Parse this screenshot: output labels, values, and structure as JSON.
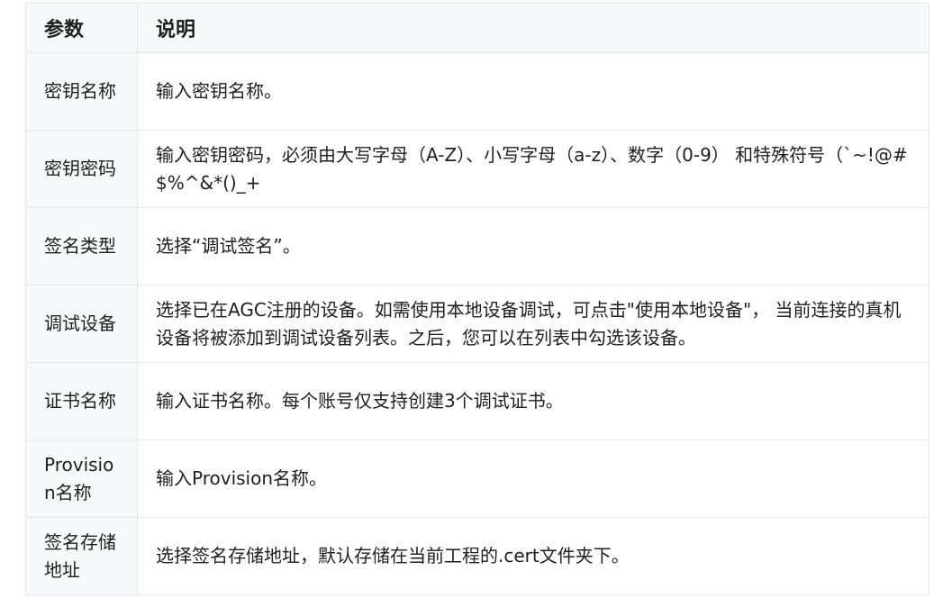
{
  "table": {
    "headers": [
      "参数",
      "说明"
    ],
    "rows": [
      {
        "param": "密钥名称",
        "desc": "输入密钥名称。"
      },
      {
        "param": "密钥密码",
        "desc": "输入密钥密码，必须由大写字母（A-Z）、小写字母（a-z）、数字（0-9） 和特殊符号（`~!@#$%^&*()_+"
      },
      {
        "param": "签名类型",
        "desc": "选择“调试签名”。"
      },
      {
        "param": "调试设备",
        "desc": "选择已在AGC注册的设备。如需使用本地设备调试，可点击\"使用本地设备\"， 当前连接的真机设备将被添加到调试设备列表。之后，您可以在列表中勾选该设备。"
      },
      {
        "param": "证书名称",
        "desc": "输入证书名称。每个账号仅支持创建3个调试证书。"
      },
      {
        "param": "Provision名称",
        "desc": "输入Provision名称。"
      },
      {
        "param": "签名存储地址",
        "desc": "选择签名存储地址，默认存储在当前工程的.cert文件夹下。"
      }
    ]
  }
}
